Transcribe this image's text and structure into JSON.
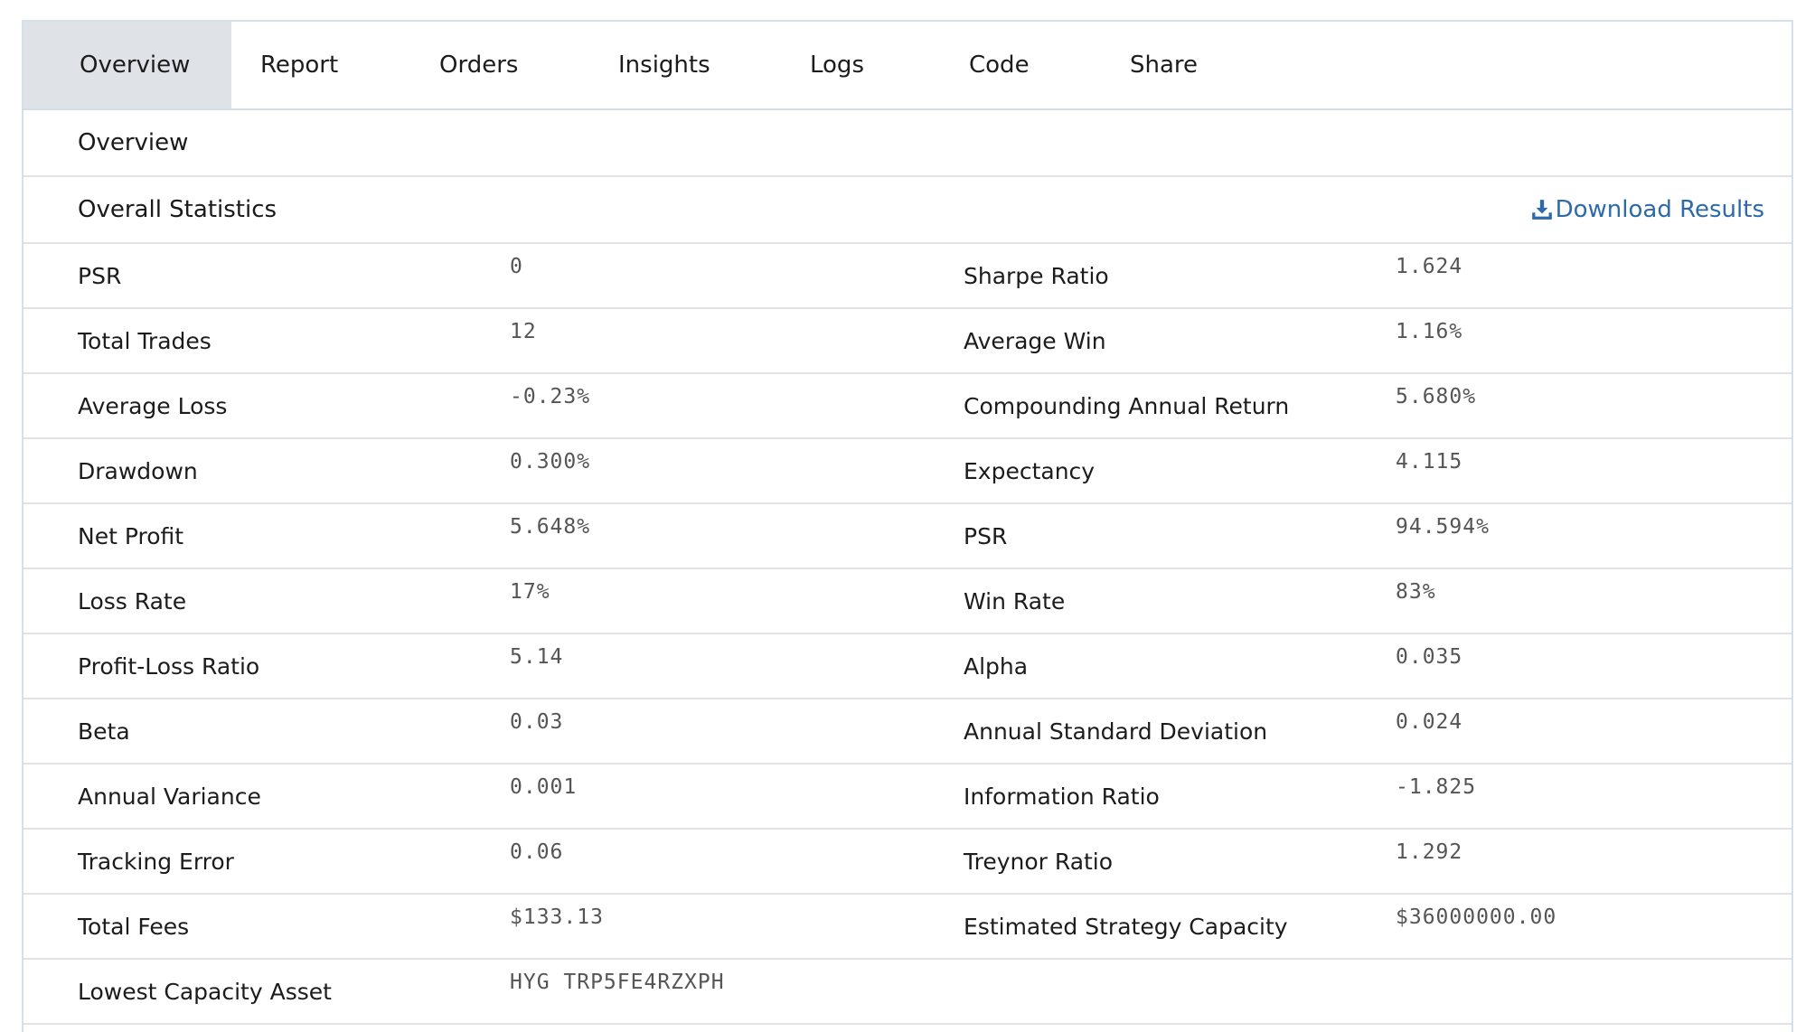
{
  "tabs": [
    "Overview",
    "Report",
    "Orders",
    "Insights",
    "Logs",
    "Code",
    "Share"
  ],
  "active_tab": "Overview",
  "section_title": "Overview",
  "stats_title": "Overall Statistics",
  "download_label": "Download Results",
  "colors": {
    "accent": "#2d6aa8",
    "active_tab_bg": "#dfe3e8",
    "border": "#dfe3e8"
  },
  "stats": [
    [
      {
        "label": "PSR",
        "value": "0"
      },
      {
        "label": "Sharpe Ratio",
        "value": "1.624"
      }
    ],
    [
      {
        "label": "Total Trades",
        "value": "12"
      },
      {
        "label": "Average Win",
        "value": "1.16%"
      }
    ],
    [
      {
        "label": "Average Loss",
        "value": "-0.23%"
      },
      {
        "label": "Compounding Annual Return",
        "value": "5.680%"
      }
    ],
    [
      {
        "label": "Drawdown",
        "value": "0.300%"
      },
      {
        "label": "Expectancy",
        "value": "4.115"
      }
    ],
    [
      {
        "label": "Net Profit",
        "value": "5.648%"
      },
      {
        "label": "PSR",
        "value": "94.594%"
      }
    ],
    [
      {
        "label": "Loss Rate",
        "value": "17%"
      },
      {
        "label": "Win Rate",
        "value": "83%"
      }
    ],
    [
      {
        "label": "Profit-Loss Ratio",
        "value": "5.14"
      },
      {
        "label": "Alpha",
        "value": "0.035"
      }
    ],
    [
      {
        "label": "Beta",
        "value": "0.03"
      },
      {
        "label": "Annual Standard Deviation",
        "value": "0.024"
      }
    ],
    [
      {
        "label": "Annual Variance",
        "value": "0.001"
      },
      {
        "label": "Information Ratio",
        "value": "-1.825"
      }
    ],
    [
      {
        "label": "Tracking Error",
        "value": "0.06"
      },
      {
        "label": "Treynor Ratio",
        "value": "1.292"
      }
    ],
    [
      {
        "label": "Total Fees",
        "value": "$133.13"
      },
      {
        "label": "Estimated Strategy Capacity",
        "value": "$36000000.00"
      }
    ],
    [
      {
        "label": "Lowest Capacity Asset",
        "value": "HYG TRP5FE4RZXPH"
      }
    ]
  ]
}
